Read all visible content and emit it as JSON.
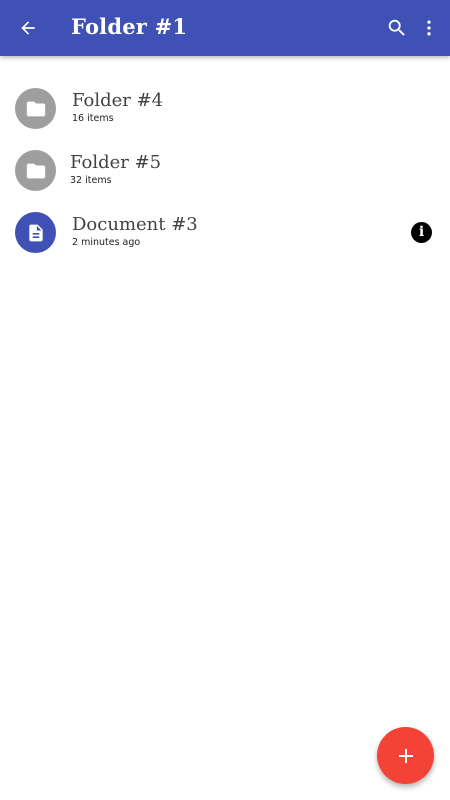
{
  "appbar": {
    "title": "Folder #1",
    "back_icon": "arrow-back-icon",
    "search_icon": "search-icon",
    "more_icon": "more-vert-icon",
    "color": "#3f51b5"
  },
  "items": [
    {
      "title": "Folder #4",
      "subtitle": "16 items",
      "icon": "folder-icon",
      "avatar_color": "#9e9e9e"
    },
    {
      "title": "Folder #5",
      "subtitle": "32 items",
      "icon": "folder-icon",
      "avatar_color": "#9e9e9e"
    },
    {
      "title": "Document #3",
      "subtitle": "2 minutes ago",
      "icon": "document-icon",
      "avatar_color": "#3f51b5",
      "action_icon": "info-icon"
    }
  ],
  "fab": {
    "icon": "add-icon",
    "color": "#f44336"
  }
}
